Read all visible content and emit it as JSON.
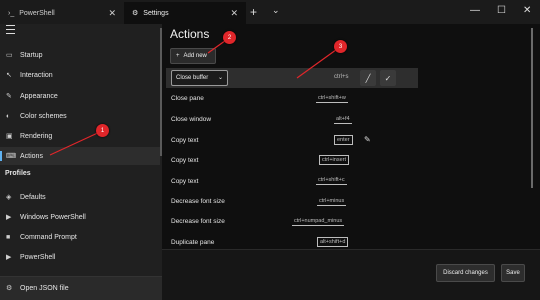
{
  "tabs": [
    {
      "label": "PowerShell",
      "icon": "terminal-icon"
    },
    {
      "label": "Settings",
      "icon": "gear-icon"
    }
  ],
  "sidebar": {
    "items": [
      {
        "label": "Startup",
        "icon": "startup-icon"
      },
      {
        "label": "Interaction",
        "icon": "interaction-icon"
      },
      {
        "label": "Appearance",
        "icon": "appearance-icon"
      },
      {
        "label": "Color schemes",
        "icon": "color-schemes-icon"
      },
      {
        "label": "Rendering",
        "icon": "rendering-icon"
      },
      {
        "label": "Actions",
        "icon": "keyboard-icon",
        "selected": true
      }
    ],
    "profiles_heading": "Profiles",
    "profiles": [
      {
        "label": "Defaults",
        "icon": "layers-icon"
      },
      {
        "label": "Windows PowerShell",
        "icon": "powershell-icon"
      },
      {
        "label": "Command Prompt",
        "icon": "cmd-icon"
      },
      {
        "label": "PowerShell",
        "icon": "powershell-icon"
      }
    ],
    "footer": "Open JSON file"
  },
  "main": {
    "title": "Actions",
    "add_new": "Add new",
    "editing": {
      "action": "Close buffer",
      "key_placeholder": "ctrl+s"
    },
    "rows": [
      {
        "label": "Close pane",
        "key": "ctrl+shift+w"
      },
      {
        "label": "Close window",
        "key": "alt+f4"
      },
      {
        "label": "Copy text",
        "key": "enter"
      },
      {
        "label": "Copy text",
        "key": "ctrl+insert"
      },
      {
        "label": "Copy text",
        "key": "ctrl+shift+c"
      },
      {
        "label": "Decrease font size",
        "key": "ctrl+minus"
      },
      {
        "label": "Decrease font size",
        "key": "ctrl+numpad_minus"
      },
      {
        "label": "Duplicate pane",
        "key": "alt+shift+d"
      }
    ]
  },
  "footer": {
    "discard": "Discard changes",
    "save": "Save"
  },
  "callouts": [
    "1",
    "2",
    "3"
  ],
  "colors": {
    "accent": "#5fb2f2",
    "callout": "#e0262a"
  }
}
